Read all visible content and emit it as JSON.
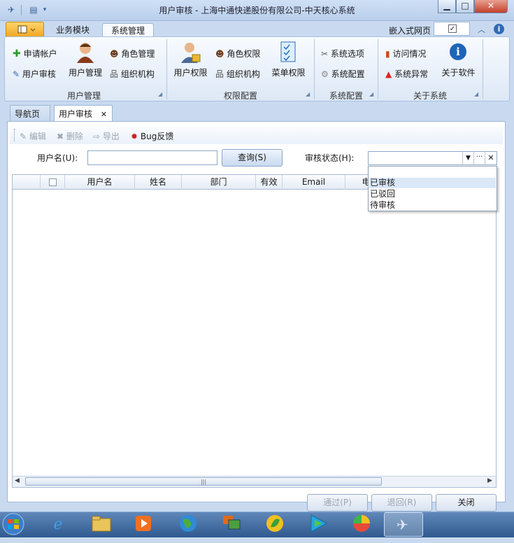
{
  "window": {
    "title": "用户审核 - 上海中通快递股份有限公司-中天核心系统",
    "min_label": "▁",
    "max_label": "□",
    "close_label": "✕"
  },
  "ribbon": {
    "tabs": [
      "业务模块",
      "系统管理"
    ],
    "embed_label": "嵌入式网页",
    "user_mgmt": {
      "label": "用户管理",
      "apply_account": "申请帐户",
      "user_audit": "用户审核",
      "user_manage": "用户管理",
      "role_manage": "角色管理",
      "org": "组织机构"
    },
    "perm": {
      "label": "权限配置",
      "user_perm": "用户权限",
      "role_perm": "角色权限",
      "org": "组织机构",
      "menu_perm": "菜单权限"
    },
    "sysconf": {
      "label": "系统配置",
      "options": "系统选项",
      "config": "系统配置"
    },
    "about": {
      "label": "关于系统",
      "visits": "访问情况",
      "errors": "系统异常",
      "about_soft": "关于软件"
    }
  },
  "doc_tabs": {
    "nav": "导航页面",
    "audit": "用户审核",
    "close": "✕"
  },
  "toolbar": {
    "edit": "编辑",
    "delete": "删除",
    "export": "导出",
    "bug": "Bug反馈"
  },
  "search": {
    "username_label": "用户名(U):",
    "query_button": "查询(S)",
    "status_label": "审核状态(H):",
    "status_value": "",
    "username_value": ""
  },
  "grid": {
    "columns": [
      "用户名",
      "姓名",
      "部门",
      "有效",
      "Email",
      "电"
    ]
  },
  "dropdown": {
    "options": [
      "已审核",
      "已驳回",
      "待审核"
    ],
    "highlighted": 0
  },
  "footer": {
    "pass": "通过(P)",
    "reject": "退回(R)",
    "close": "关闭"
  },
  "colors": {
    "accent": "#2e6cb8",
    "ribbon_bg": "#dde8f6",
    "dropdown_highlight": "#dbe8f8"
  }
}
